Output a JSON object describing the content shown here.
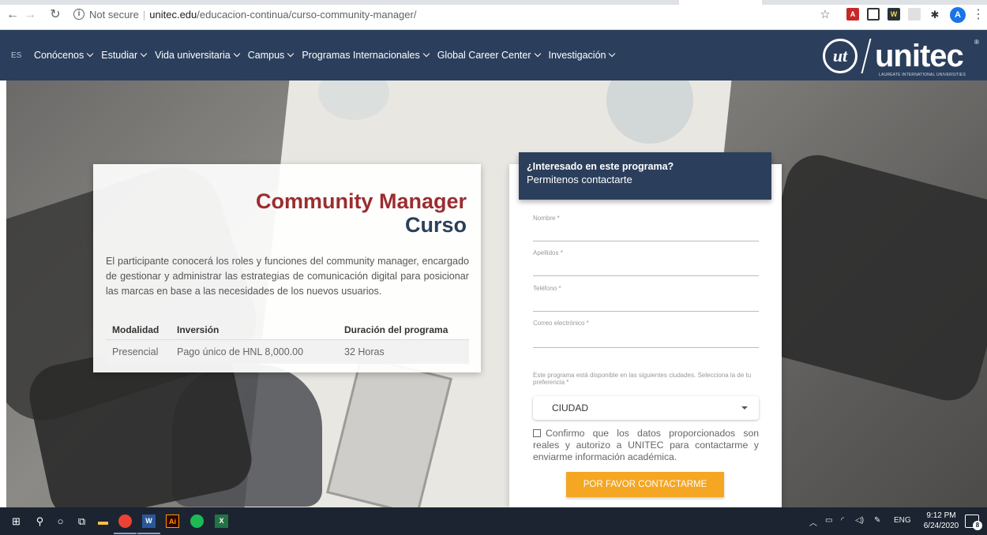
{
  "browser": {
    "url_security": "Not secure",
    "url_host": "unitec.edu",
    "url_path": "/educacion-continua/curso-community-manager/",
    "avatar_letter": "A"
  },
  "sitenav": {
    "lang": "ES",
    "menu": [
      {
        "label": "Conócenos"
      },
      {
        "label": "Estudiar"
      },
      {
        "label": "Vida universitaria"
      },
      {
        "label": "Campus"
      },
      {
        "label": "Programas Internacionales"
      },
      {
        "label": "Global Career Center"
      },
      {
        "label": "Investigación"
      }
    ],
    "logo_mark": "ut",
    "logo_word": "unitec",
    "logo_sub": "LAUREATE INTERNATIONAL UNIVERSITIES",
    "logo_reg": "®"
  },
  "course": {
    "title_line1": "Community Manager",
    "title_line2": "Curso",
    "description": "El participante conocerá los roles y funciones del community manager, encargado de gestionar y administrar las estrategias de comunicación digital para posicionar las marcas en base a las necesidades de los nuevos usuarios.",
    "table": {
      "headers": [
        "Modalidad",
        "Inversión",
        "Duración del programa"
      ],
      "row": [
        "Presencial",
        "Pago único de HNL 8,000.00",
        "32 Horas"
      ]
    }
  },
  "form": {
    "header_title": "¿Interesado en este programa?",
    "header_subtitle": "Permitenos contactarte",
    "fields": [
      {
        "label": "Nombre *",
        "value": ""
      },
      {
        "label": "Apellidos *",
        "value": ""
      },
      {
        "label": "Teléfono *",
        "value": ""
      },
      {
        "label": "Correo electrónico *",
        "value": ""
      }
    ],
    "city_note": "Este programa está disponible en las siguientes ciudades. Selecciona la de tu preferencia *",
    "city_select": "CIUDAD",
    "consent": "Confirmo que los datos proporcionados son reales y autorizo a UNITEC para contactarme y enviarme información académica.",
    "submit": "POR FAVOR CONTACTARME"
  },
  "taskbar": {
    "lang": "ENG",
    "time": "9:12 PM",
    "date": "6/24/2020",
    "notif_count": "8"
  },
  "colors": {
    "nav_bg": "#2b3f5c",
    "title_red": "#9b2d30",
    "button_orange": "#f5a623"
  }
}
